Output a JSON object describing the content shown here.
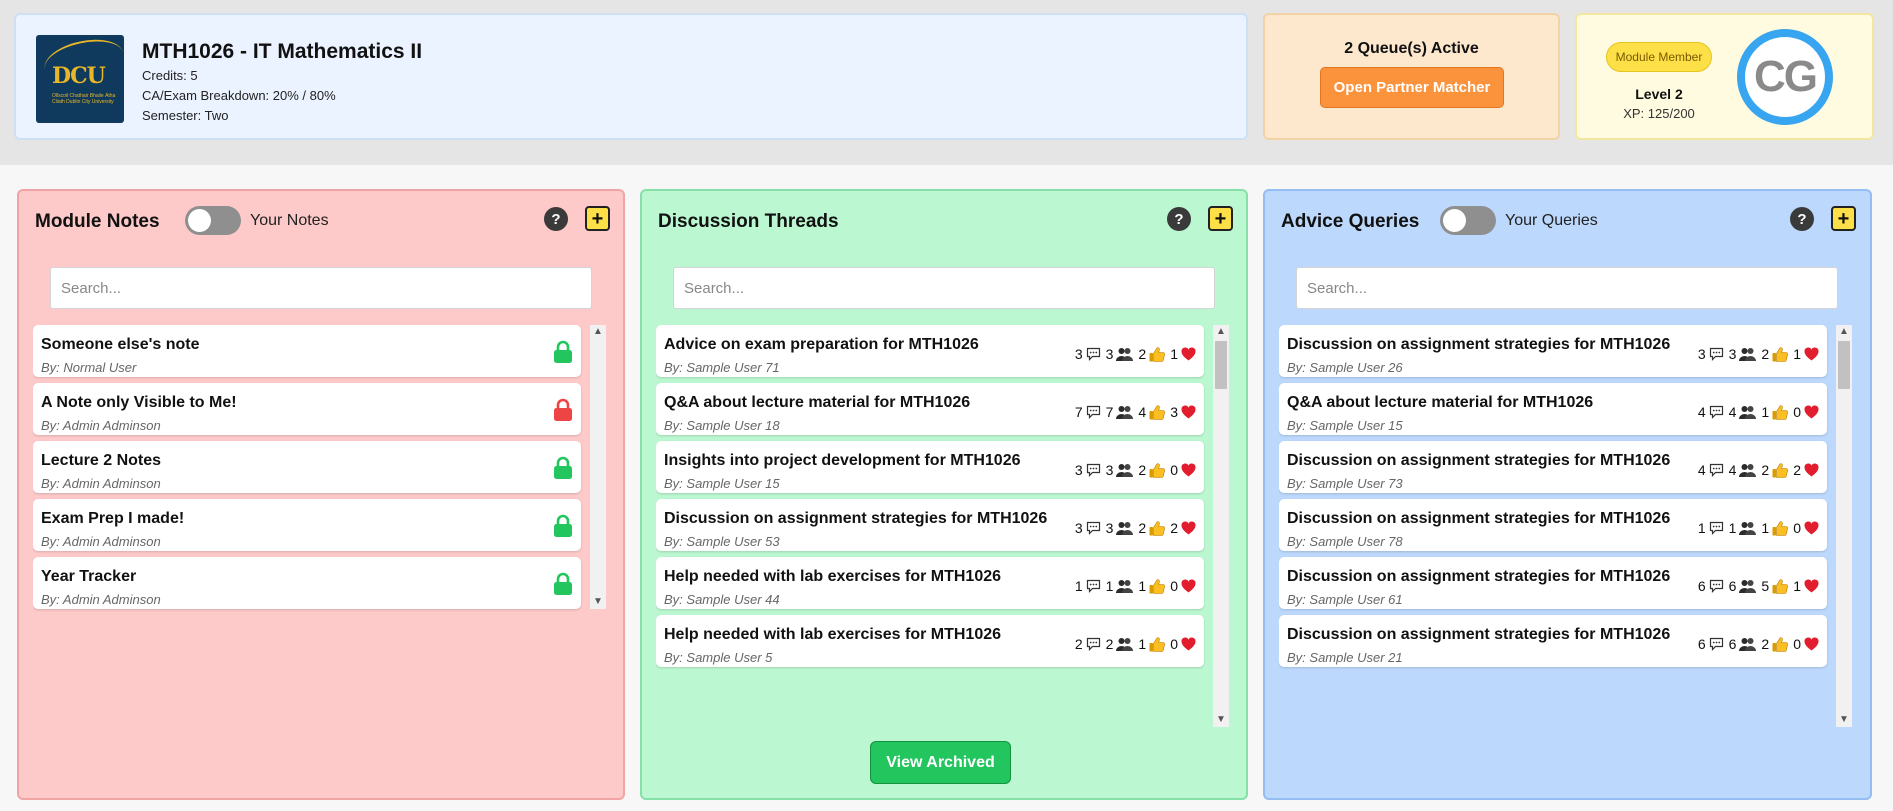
{
  "module": {
    "logo_text": "DCU",
    "logo_sub": "Ollscoil Chathair Bhaile Átha Cliath Dublin City University",
    "title": "MTH1026 - IT Mathematics II",
    "credits": "Credits: 5",
    "breakdown": "CA/Exam Breakdown: 20% / 80%",
    "semester": "Semester: Two"
  },
  "queue": {
    "status": "2 Queue(s) Active",
    "button_label": "Open Partner Matcher"
  },
  "user": {
    "badge": "Module Member",
    "level": "Level 2",
    "xp": "XP: 125/200",
    "xp_progress": 0.625,
    "initials": "CG"
  },
  "notes": {
    "title": "Module Notes",
    "toggle_label": "Your Notes",
    "help": "?",
    "add": "+",
    "search_placeholder": "Search...",
    "items": [
      {
        "title": "Someone else's note",
        "author": "By: Normal User",
        "lock": "unlocked"
      },
      {
        "title": "A Note only Visible to Me!",
        "author": "By: Admin Adminson",
        "lock": "locked"
      },
      {
        "title": "Lecture 2 Notes",
        "author": "By: Admin Adminson",
        "lock": "unlocked"
      },
      {
        "title": "Exam Prep I made!",
        "author": "By: Admin Adminson",
        "lock": "unlocked"
      },
      {
        "title": "Year Tracker",
        "author": "By: Admin Adminson",
        "lock": "unlocked"
      }
    ]
  },
  "threads": {
    "title": "Discussion Threads",
    "help": "?",
    "add": "+",
    "search_placeholder": "Search...",
    "archived_label": "View Archived",
    "items": [
      {
        "title": "Advice on exam preparation for MTH1026",
        "author": "By: Sample User 71",
        "comments": "3",
        "participants": "3",
        "likes": "2",
        "hearts": "1"
      },
      {
        "title": "Q&A about lecture material for MTH1026",
        "author": "By: Sample User 18",
        "comments": "7",
        "participants": "7",
        "likes": "4",
        "hearts": "3"
      },
      {
        "title": "Insights into project development for MTH1026",
        "author": "By: Sample User 15",
        "comments": "3",
        "participants": "3",
        "likes": "2",
        "hearts": "0"
      },
      {
        "title": "Discussion on assignment strategies for MTH1026",
        "author": "By: Sample User 53",
        "comments": "3",
        "participants": "3",
        "likes": "2",
        "hearts": "2"
      },
      {
        "title": "Help needed with lab exercises for MTH1026",
        "author": "By: Sample User 44",
        "comments": "1",
        "participants": "1",
        "likes": "1",
        "hearts": "0"
      },
      {
        "title": "Help needed with lab exercises for MTH1026",
        "author": "By: Sample User 5",
        "comments": "2",
        "participants": "2",
        "likes": "1",
        "hearts": "0"
      }
    ]
  },
  "queries": {
    "title": "Advice Queries",
    "toggle_label": "Your Queries",
    "help": "?",
    "add": "+",
    "search_placeholder": "Search...",
    "items": [
      {
        "title": "Discussion on assignment strategies for MTH1026",
        "author": "By: Sample User 26",
        "comments": "3",
        "participants": "3",
        "likes": "2",
        "hearts": "1"
      },
      {
        "title": "Q&A about lecture material for MTH1026",
        "author": "By: Sample User 15",
        "comments": "4",
        "participants": "4",
        "likes": "1",
        "hearts": "0"
      },
      {
        "title": "Discussion on assignment strategies for MTH1026",
        "author": "By: Sample User 73",
        "comments": "4",
        "participants": "4",
        "likes": "2",
        "hearts": "2"
      },
      {
        "title": "Discussion on assignment strategies for MTH1026",
        "author": "By: Sample User 78",
        "comments": "1",
        "participants": "1",
        "likes": "1",
        "hearts": "0"
      },
      {
        "title": "Discussion on assignment strategies for MTH1026",
        "author": "By: Sample User 61",
        "comments": "6",
        "participants": "6",
        "likes": "5",
        "hearts": "1"
      },
      {
        "title": "Discussion on assignment strategies for MTH1026",
        "author": "By: Sample User 21",
        "comments": "6",
        "participants": "6",
        "likes": "2",
        "hearts": "0"
      }
    ]
  },
  "icons": {
    "help": "question-circle-icon",
    "add": "plus-square-icon",
    "lock_open": "green-lock-icon",
    "lock_closed": "red-lock-icon",
    "comment": "speech-bubble-icon",
    "participants": "people-icon",
    "like": "thumbs-up-icon",
    "heart": "heart-icon"
  },
  "colors": {
    "notes_bg": "#fdc9c9",
    "threads_bg": "#bbf7d0",
    "queries_bg": "#bcd8fc",
    "accent_orange": "#fb923c",
    "accent_green": "#22c55e",
    "accent_yellow": "#fde047",
    "lock_green": "#22c55e",
    "lock_red": "#ef4444",
    "avatar_ring": "#38a5f0"
  }
}
